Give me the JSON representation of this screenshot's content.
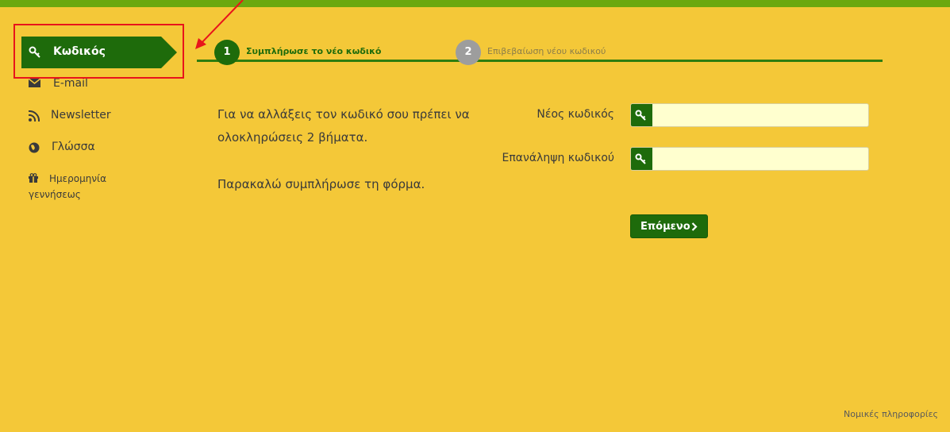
{
  "sidebar": {
    "active": {
      "label": "Κωδικός",
      "icon": "key-icon"
    },
    "items": [
      {
        "label": "E-mail",
        "icon": "envelope-icon"
      },
      {
        "label": "Newsletter",
        "icon": "rss-icon"
      },
      {
        "label": "Γλώσσα",
        "icon": "globe-icon"
      },
      {
        "label": "Ημερομηνία γεννήσεως",
        "icon": "gift-icon"
      }
    ]
  },
  "steps": [
    {
      "number": "1",
      "label": "Συμπλήρωσε το νέο κωδικό",
      "active": true
    },
    {
      "number": "2",
      "label": "Επιβεβαίωση νέου κωδικού",
      "active": false
    }
  ],
  "intro": {
    "line1": "Για να αλλάξεις τον κωδικό σου πρέπει να ολοκληρώσεις 2 βήματα.",
    "line2": "Παρακαλώ συμπλήρωσε τη φόρμα."
  },
  "form": {
    "new_password_label": "Νέος κωδικός",
    "new_password_value": "",
    "repeat_password_label": "Επανάληψη κωδικού",
    "repeat_password_value": "",
    "next_label": "Επόμενο"
  },
  "footer": {
    "legal_label": "Νομικές πληροφορίες"
  },
  "colors": {
    "background": "#F4C838",
    "topbar": "#6BA80F",
    "primary": "#1E6B0B",
    "input_bg": "#FFFFCF",
    "inactive_step": "#9D9D9D",
    "highlight": "#E8141B"
  }
}
